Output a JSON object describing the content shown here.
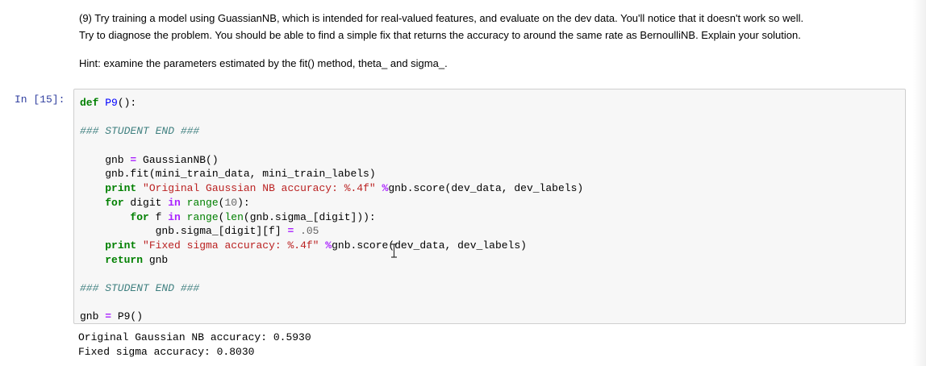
{
  "markdown": {
    "line1": "(9) Try training a model using GuassianNB, which is intended for real-valued features, and evaluate on the dev data. You'll notice that it doesn't work so well.",
    "line2": "Try to diagnose the problem. You should be able to find a simple fix that returns the accuracy to around the same rate as BernoulliNB. Explain your solution.",
    "hint": "Hint: examine the parameters estimated by the fit() method, theta_ and sigma_."
  },
  "cell": {
    "prompt": "In [15]:",
    "code": {
      "l1_kw": "def",
      "l1_fn": "P9",
      "l1_rest": "():",
      "l3_comment": "### STUDENT END ###",
      "l5_pre": "    gnb ",
      "l5_op": "=",
      "l5_rest": " GaussianNB()",
      "l6": "    gnb.fit(mini_train_data, mini_train_labels)",
      "l7_kw": "print",
      "l7_str": "\"Original Gaussian NB accuracy: %.4f\"",
      "l7_op": "%",
      "l7_rest": "gnb.score(dev_data, dev_labels)",
      "l8_kw": "for",
      "l8_mid": " digit ",
      "l8_in": "in",
      "l8_bi": "range",
      "l8_p1": "(",
      "l8_num": "10",
      "l8_p2": "):",
      "l9_kw": "for",
      "l9_mid": " f ",
      "l9_in": "in",
      "l9_bi1": "range",
      "l9_p1": "(",
      "l9_bi2": "len",
      "l9_rest": "(gnb.sigma_[digit])):",
      "l10_pre": "            gnb.sigma_[digit][f] ",
      "l10_op": "=",
      "l10_num": ".05",
      "l11_kw": "print",
      "l11_str": "\"Fixed sigma accuracy: %.4f\"",
      "l11_op": "%",
      "l11_rest": "gnb.score(dev_data, dev_labels)",
      "l12_kw": "return",
      "l12_rest": " gnb",
      "l14_comment": "### STUDENT END ###",
      "l16_pre": "gnb ",
      "l16_op": "=",
      "l16_rest": " P9()"
    }
  },
  "output": {
    "line1": "Original Gaussian NB accuracy: 0.5930",
    "line2": "Fixed sigma accuracy: 0.8030"
  },
  "colors": {
    "prompt": "#303f9f",
    "keyword": "#008000",
    "string": "#ba2121",
    "comment": "#408080",
    "operator": "#aa22ff"
  },
  "icons": {
    "cursor": "text-cursor-icon"
  }
}
